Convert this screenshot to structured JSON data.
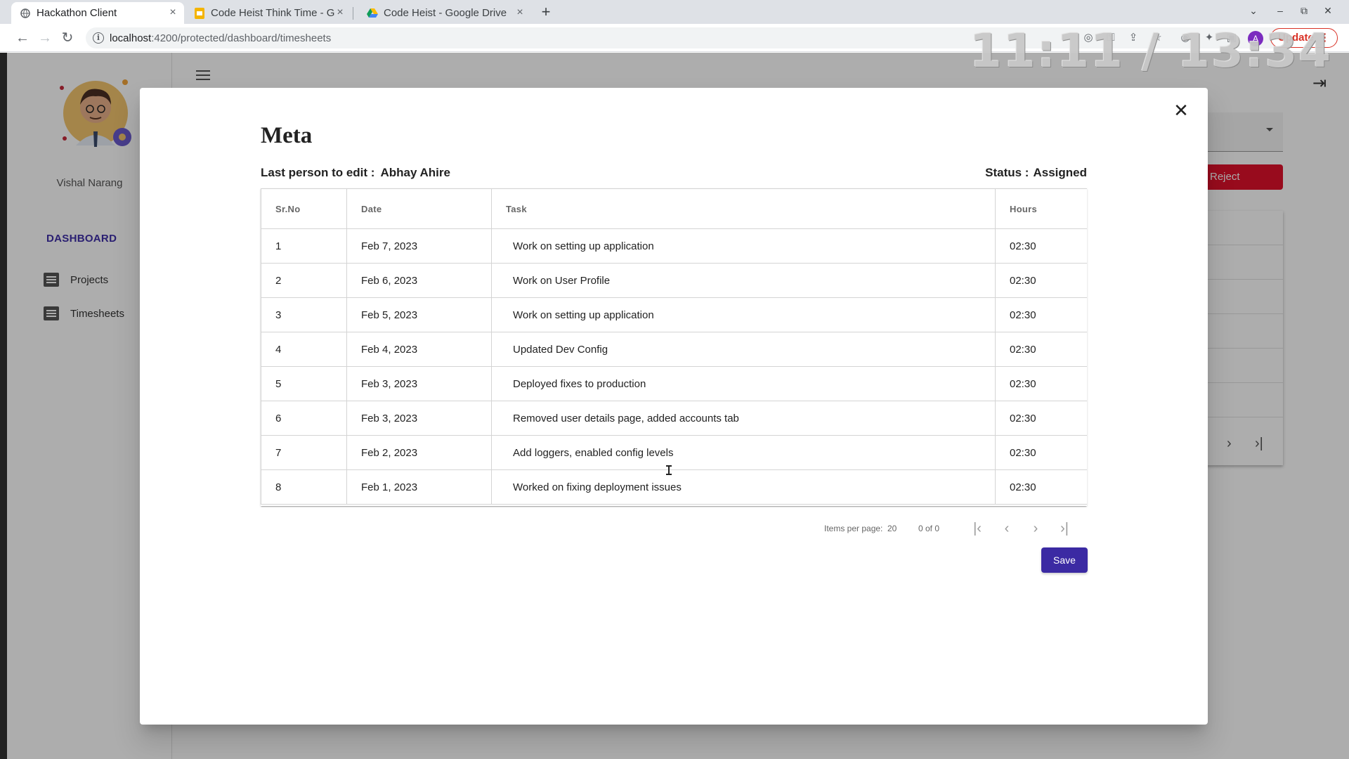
{
  "browser": {
    "tabs": [
      {
        "title": "Hackathon Client",
        "active": true,
        "icon": "globe-icon"
      },
      {
        "title": "Code Heist Think Time - G",
        "active": false,
        "icon": "slides-icon"
      },
      {
        "title": "Code Heist - Google Drive",
        "active": false,
        "icon": "drive-icon"
      }
    ],
    "url_host": "localhost",
    "url_path": ":4200/protected/dashboard/timesheets",
    "update_label": "Update",
    "profile_initial": "A"
  },
  "overlay_clock": "11:11 / 13:34",
  "sidebar": {
    "user_name": "Vishal Narang",
    "section": "DASHBOARD",
    "items": [
      {
        "label": "Projects",
        "icon": "chat-icon"
      },
      {
        "label": "Timesheets",
        "icon": "chat-icon"
      }
    ]
  },
  "background": {
    "reject_label": "Reject"
  },
  "dialog": {
    "title": "Meta",
    "last_edit_label": "Last person to edit :",
    "last_edit_value": "Abhay Ahire",
    "status_label": "Status :",
    "status_value": "Assigned",
    "columns": [
      "Sr.No",
      "Date",
      "Task",
      "Hours"
    ],
    "rows": [
      {
        "sr": "1",
        "date": "Feb 7, 2023",
        "task": "Work on setting up application",
        "hours": "02:30"
      },
      {
        "sr": "2",
        "date": "Feb 6, 2023",
        "task": "Work on User Profile",
        "hours": "02:30"
      },
      {
        "sr": "3",
        "date": "Feb 5, 2023",
        "task": "Work on setting up application",
        "hours": "02:30"
      },
      {
        "sr": "4",
        "date": "Feb 4, 2023",
        "task": "Updated Dev Config",
        "hours": "02:30"
      },
      {
        "sr": "5",
        "date": "Feb 3, 2023",
        "task": "Deployed fixes to production",
        "hours": "02:30"
      },
      {
        "sr": "6",
        "date": "Feb 3, 2023",
        "task": "Removed user details page, added accounts tab",
        "hours": "02:30"
      },
      {
        "sr": "7",
        "date": "Feb 2, 2023",
        "task": "Add loggers, enabled config levels",
        "hours": "02:30"
      },
      {
        "sr": "8",
        "date": "Feb 1, 2023",
        "task": "Worked on fixing deployment issues",
        "hours": "02:30"
      }
    ],
    "paginator": {
      "items_per_page_label": "Items per page:",
      "items_per_page": "20",
      "range": "0 of 0"
    },
    "save_label": "Save"
  },
  "colors": {
    "primary": "#3b2aa3",
    "reject": "#e0112b",
    "dashboard_link": "#3f2fa8"
  }
}
